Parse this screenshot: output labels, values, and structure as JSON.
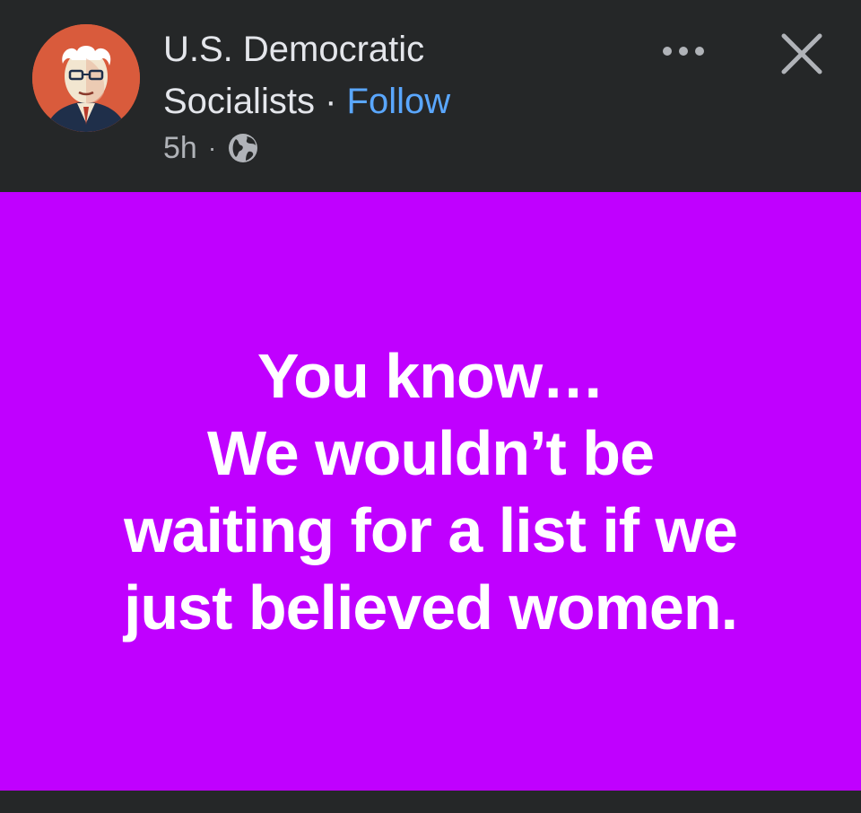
{
  "post": {
    "author": {
      "name_line1": "U.S. Democratic",
      "name_line2": "Socialists",
      "separator": "·",
      "follow_label": "Follow"
    },
    "meta": {
      "time": "5h",
      "separator": "·",
      "audience_icon": "globe-icon"
    },
    "actions": {
      "more_icon": "more-icon",
      "close_icon": "close-icon"
    },
    "content": {
      "background_color": "#c000ff",
      "lines": [
        "You know…",
        "We wouldn’t be",
        "waiting for a list if we",
        "just believed women."
      ]
    }
  },
  "colors": {
    "header_bg": "#252728",
    "follow_link": "#5aa7ff",
    "avatar_bg": "#d95b3c"
  }
}
